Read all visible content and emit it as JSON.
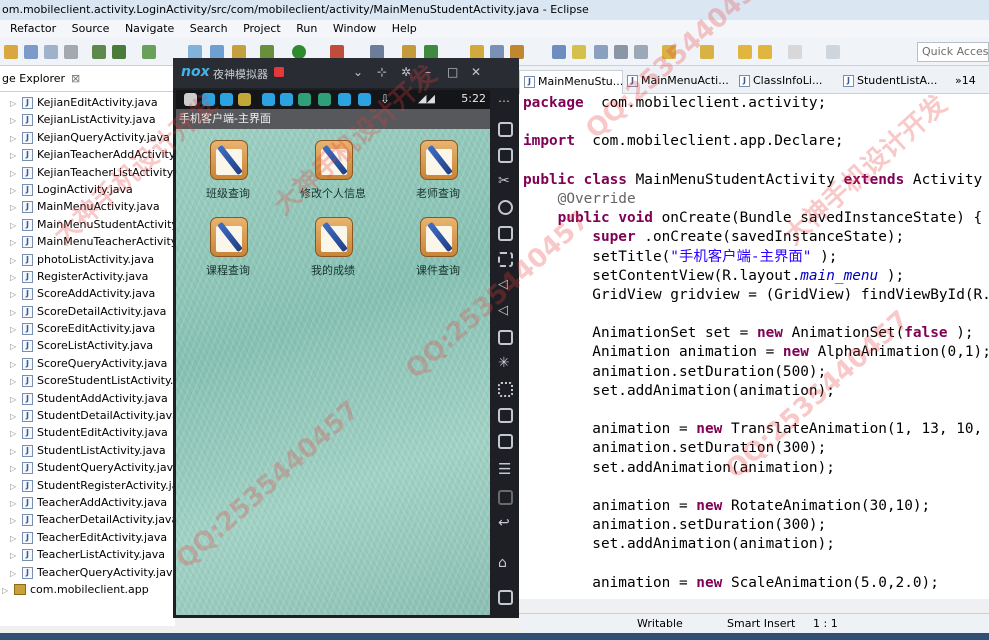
{
  "window": {
    "title": "om.mobileclient.activity.LoginActivity/src/com/mobileclient/activity/MainMenuStudentActivity.java - Eclipse"
  },
  "menu": [
    "Refactor",
    "Source",
    "Navigate",
    "Search",
    "Project",
    "Run",
    "Window",
    "Help"
  ],
  "toolbar": {
    "quick_access_placeholder": "Quick Access"
  },
  "explorer": {
    "tab_label": "ge Explorer",
    "close_glyph": "⊠",
    "files": [
      "KejianEditActivity.java",
      "KejianListActivity.java",
      "KejianQueryActivity.java",
      "KejianTeacherAddActivity.j",
      "KejianTeacherListActivity.ja",
      "LoginActivity.java",
      "MainMenuActivity.java",
      "MainMenuStudentActivity.j",
      "MainMenuTeacherActivity.",
      "photoListActivity.java",
      "RegisterActivity.java",
      "ScoreAddActivity.java",
      "ScoreDetailActivity.java",
      "ScoreEditActivity.java",
      "ScoreListActivity.java",
      "ScoreQueryActivity.java",
      "ScoreStudentListActivity.ja",
      "StudentAddActivity.java",
      "StudentDetailActivity.java",
      "StudentEditActivity.java",
      "StudentListActivity.java",
      "StudentQueryActivity.java",
      "StudentRegisterActivity.jav",
      "TeacherAddActivity.java",
      "TeacherDetailActivity.java",
      "TeacherEditActivity.java",
      "TeacherListActivity.java",
      "TeacherQueryActivity.java"
    ],
    "package": "com.mobileclient.app"
  },
  "emulator": {
    "logo": "nox",
    "name": "夜神模拟器",
    "time": "5:22",
    "app_title": "手机客户端-主界面",
    "tiles": [
      "班级查询",
      "修改个人信息",
      "老师查询",
      "课程查询",
      "我的成绩",
      "课件查询"
    ]
  },
  "editor": {
    "tabs": [
      "MainMenuStu...",
      "MainMenuActi...",
      "ClassInfoLi...",
      "StudentListA..."
    ],
    "overflow": "»14",
    "lines": [
      [
        [
          "kw",
          "package"
        ],
        [
          "",
          "  com.mobileclient.activity;"
        ]
      ],
      [],
      [
        [
          "kw",
          "import"
        ],
        [
          "",
          "  com.mobileclient.app.Declare;"
        ]
      ],
      [],
      [
        [
          "kw",
          "public"
        ],
        [
          "",
          " "
        ],
        [
          "kw",
          "class"
        ],
        [
          "",
          "",
          " MainMenuStudentActivity "
        ],
        [
          "kw",
          "extends"
        ],
        [
          "",
          "",
          " Activity"
        ]
      ],
      [
        [
          "",
          ""
        ],
        [
          "an",
          "    @Override"
        ]
      ],
      [
        [
          "",
          "    "
        ],
        [
          "kw",
          "public"
        ],
        [
          "",
          "",
          " "
        ],
        [
          "kw",
          "void"
        ],
        [
          "",
          "",
          " onCreate(Bundle savedInstanceState) {"
        ]
      ],
      [
        [
          "",
          "        "
        ],
        [
          "kw",
          "super"
        ],
        [
          "",
          "",
          " .onCreate(savedInstanceState);"
        ]
      ],
      [
        [
          "",
          "        setTitle("
        ],
        [
          "st",
          "\"手机客户端-主界面\""
        ],
        [
          "",
          "",
          " );"
        ]
      ],
      [
        [
          "",
          "        setContentView(R.layout."
        ],
        [
          "fi",
          "main_menu"
        ],
        [
          "",
          "",
          " );"
        ]
      ],
      [
        [
          "",
          "        GridView gridview = (GridView) findViewById(R."
        ]
      ],
      [],
      [
        [
          "",
          "        AnimationSet set = "
        ],
        [
          "kw",
          "new"
        ],
        [
          "",
          "",
          " AnimationSet("
        ],
        [
          "kw",
          "false"
        ],
        [
          "",
          "",
          " );"
        ]
      ],
      [
        [
          "",
          "        Animation animation = "
        ],
        [
          "kw",
          "new"
        ],
        [
          "",
          "",
          " AlphaAnimation(0,1);"
        ]
      ],
      [
        [
          "",
          "        animation.setDuration(500);"
        ]
      ],
      [
        [
          "",
          "        set.addAnimation(animation);"
        ]
      ],
      [],
      [
        [
          "",
          "        animation = "
        ],
        [
          "kw",
          "new"
        ],
        [
          "",
          "",
          " TranslateAnimation(1, 13, 10,"
        ]
      ],
      [
        [
          "",
          "        animation.setDuration(300);"
        ]
      ],
      [
        [
          "",
          "        set.addAnimation(animation);"
        ]
      ],
      [],
      [
        [
          "",
          "        animation = "
        ],
        [
          "kw",
          "new"
        ],
        [
          "",
          "",
          " RotateAnimation(30,10);"
        ]
      ],
      [
        [
          "",
          "        animation.setDuration(300);"
        ]
      ],
      [
        [
          "",
          "        set.addAnimation(animation);"
        ]
      ],
      [],
      [
        [
          "",
          "        animation = "
        ],
        [
          "kw",
          "new"
        ],
        [
          "",
          "",
          " ScaleAnimation(5.0,2.0);"
        ]
      ]
    ]
  },
  "status": {
    "writable": "Writable",
    "insert_mode": "Smart Insert",
    "position": "1 : 1"
  },
  "watermark": {
    "text_qq": "QQ:2535440457",
    "text_cn": "大神手机设计开发"
  }
}
